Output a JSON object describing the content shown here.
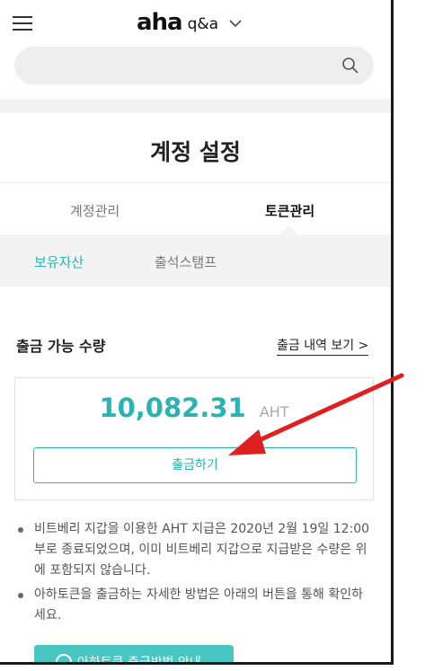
{
  "header": {
    "logo_text": "aha",
    "logo_sub": "q&a",
    "search": {
      "placeholder": ""
    }
  },
  "page": {
    "title": "계정 설정"
  },
  "tabs": [
    {
      "label": "계정관리",
      "active": false
    },
    {
      "label": "토큰관리",
      "active": true
    }
  ],
  "subtabs": [
    {
      "label": "보유자산",
      "active": true
    },
    {
      "label": "출석스탬프",
      "active": false
    }
  ],
  "withdraw": {
    "heading": "출금 가능 수량",
    "history_link": "출금 내역 보기 >",
    "amount": "10,082.31",
    "unit": "AHT",
    "button_label": "출금하기"
  },
  "notes": [
    "비트베리 지갑을 이용한 AHT 지급은 2020년 2월 19일 12:00부로 종료되었으며, 이미 비트베리 지갑으로 지급받은 수량은 위에 포함되지 않습니다.",
    "아하토큰을 출금하는 자세한 방법은 아래의 버튼을 통해 확인하세요."
  ],
  "guide_button": {
    "label": "아하토큰 출금방법 안내"
  },
  "colors": {
    "accent": "#2bb3b3",
    "annotation": "#e02020"
  },
  "icons": [
    "menu-icon",
    "chevron-down-icon",
    "search-icon",
    "info-circle-icon"
  ]
}
